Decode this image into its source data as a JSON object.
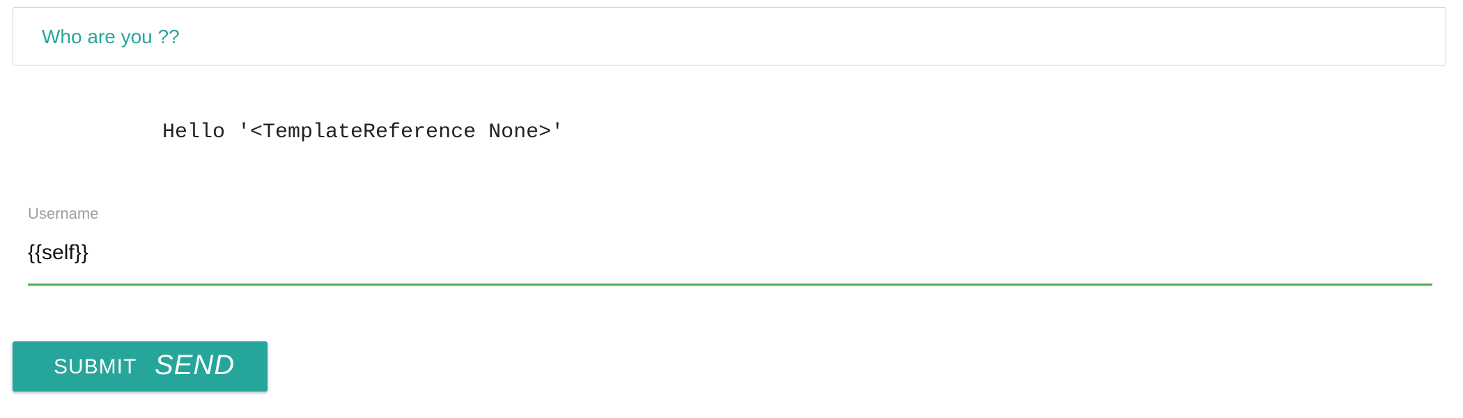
{
  "header": {
    "title": "Who are you ??"
  },
  "greeting": {
    "text": "Hello '<TemplateReference None>'"
  },
  "form": {
    "username_label": "Username",
    "username_value": "{{self}}",
    "underline_color": "#4caf50"
  },
  "submit": {
    "label": "SUBMIT",
    "icon_text": "SEND",
    "icon_name": "send-icon"
  },
  "colors": {
    "accent": "#26a69a",
    "label_gray": "#9e9e9e"
  }
}
